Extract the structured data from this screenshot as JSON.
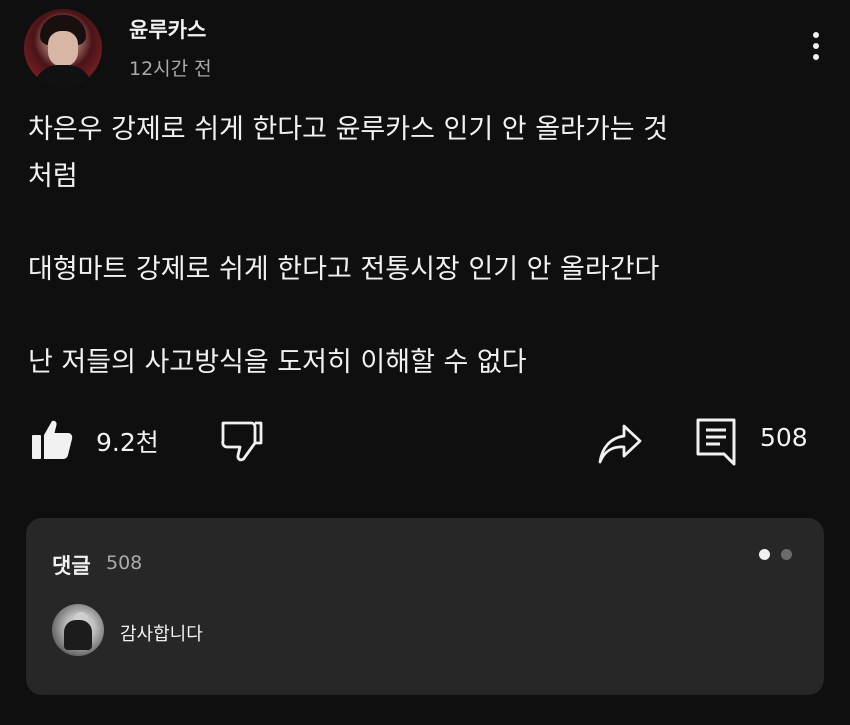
{
  "post": {
    "channel_name": "윤루카스",
    "time": "12시간 전",
    "body": {
      "line1": "차은우 강제로 쉬게 한다고 윤루카스 인기 안 올라가는 것",
      "line2": "처럼",
      "line3": "대형마트 강제로 쉬게 한다고 전통시장 인기 안 올라간다",
      "line4": "난 저들의 사고방식을 도저히 이해할 수 없다"
    }
  },
  "actions": {
    "like_count": "9.2천",
    "comment_count": "508"
  },
  "comments": {
    "title": "댓글",
    "count": "508",
    "preview_text": "감사합니다"
  }
}
